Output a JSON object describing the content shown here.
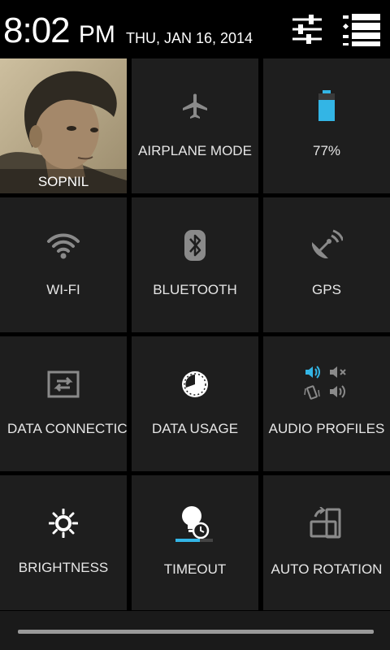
{
  "status": {
    "time": "8:02",
    "ampm": "PM",
    "date": "THU, JAN 16, 2014"
  },
  "header": {
    "settings_icon": "sliders-icon",
    "list_icon": "list-settings-icon"
  },
  "profile": {
    "name": "SOPNIL"
  },
  "tiles": {
    "airplane": {
      "label": "AIRPLANE MODE",
      "icon": "airplane-icon"
    },
    "battery": {
      "label": "77%",
      "icon": "battery-icon",
      "level": 0.77,
      "color": "#33b5e5"
    },
    "wifi": {
      "label": "WI-FI",
      "icon": "wifi-icon"
    },
    "bluetooth": {
      "label": "BLUETOOTH",
      "icon": "bluetooth-icon"
    },
    "gps": {
      "label": "GPS",
      "icon": "gps-icon"
    },
    "data_connection": {
      "label": "DATA CONNECTIC",
      "icon": "data-connection-icon"
    },
    "data_usage": {
      "label": "DATA USAGE",
      "icon": "data-usage-icon"
    },
    "audio_profiles": {
      "label": "AUDIO PROFILES",
      "icon": "audio-profiles-icon"
    },
    "brightness": {
      "label": "BRIGHTNESS",
      "icon": "brightness-icon"
    },
    "timeout": {
      "label": "TIMEOUT",
      "icon": "timeout-icon"
    },
    "auto_rotation": {
      "label": "AUTO ROTATION",
      "icon": "auto-rotation-icon"
    }
  },
  "colors": {
    "accent": "#33b5e5",
    "tile_bg": "#1e1e1e",
    "icon_gray": "#8a8a8a"
  }
}
